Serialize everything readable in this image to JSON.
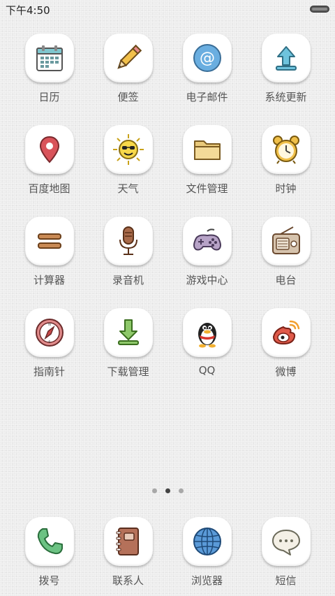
{
  "status_bar": {
    "time": "下午4:50",
    "battery_icon": "battery-icon"
  },
  "apps": [
    {
      "label": "日历",
      "icon": "calendar-icon"
    },
    {
      "label": "便签",
      "icon": "pencil-icon"
    },
    {
      "label": "电子邮件",
      "icon": "email-at-icon"
    },
    {
      "label": "系统更新",
      "icon": "update-arrow-icon"
    },
    {
      "label": "百度地图",
      "icon": "map-pin-icon"
    },
    {
      "label": "天气",
      "icon": "sun-icon"
    },
    {
      "label": "文件管理",
      "icon": "folder-icon"
    },
    {
      "label": "时钟",
      "icon": "alarm-clock-icon"
    },
    {
      "label": "计算器",
      "icon": "calculator-icon"
    },
    {
      "label": "录音机",
      "icon": "microphone-icon"
    },
    {
      "label": "游戏中心",
      "icon": "gamepad-icon"
    },
    {
      "label": "电台",
      "icon": "radio-icon"
    },
    {
      "label": "指南针",
      "icon": "compass-icon"
    },
    {
      "label": "下载管理",
      "icon": "download-icon"
    },
    {
      "label": "QQ",
      "icon": "qq-penguin-icon"
    },
    {
      "label": "微博",
      "icon": "weibo-icon"
    }
  ],
  "page_indicator": {
    "total": 3,
    "active": 1
  },
  "dock": [
    {
      "label": "拨号",
      "icon": "phone-icon"
    },
    {
      "label": "联系人",
      "icon": "contacts-book-icon"
    },
    {
      "label": "浏览器",
      "icon": "globe-icon"
    },
    {
      "label": "短信",
      "icon": "message-bubble-icon"
    }
  ]
}
